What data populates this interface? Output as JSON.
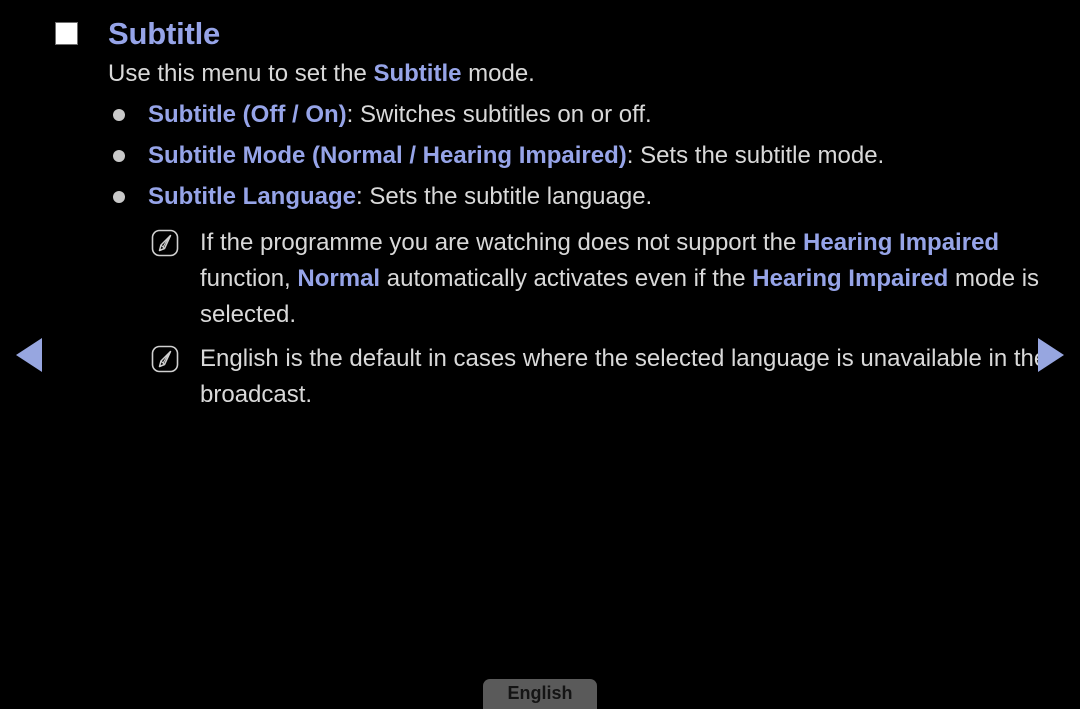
{
  "screen": {
    "background_color": "#000000",
    "accent_blue": "#96a4e8",
    "body_text_color": "#d9d9d9"
  },
  "heading": {
    "marker_icon": "white-square-icon",
    "title": "Subtitle"
  },
  "lead": {
    "before": "Use this menu to set the ",
    "emphasis": "Subtitle",
    "after": " mode."
  },
  "bullets": [
    {
      "bullet_icon": "dot-bullet-icon",
      "term": "Subtitle (Off / On)",
      "separator": ": ",
      "description": "Switches subtitles on or off."
    },
    {
      "bullet_icon": "dot-bullet-icon",
      "term": "Subtitle Mode (Normal / Hearing Impaired)",
      "separator": ": ",
      "description": "Sets the subtitle mode."
    },
    {
      "bullet_icon": "dot-bullet-icon",
      "term": "Subtitle Language",
      "separator": ": ",
      "description": "Sets the subtitle language."
    }
  ],
  "notes": [
    {
      "icon": "note-pencil-icon",
      "segments": [
        {
          "text": "If the programme you are watching does not support the ",
          "style": "normal"
        },
        {
          "text": "Hearing Impaired",
          "style": "blue-bold"
        },
        {
          "text": " function, ",
          "style": "normal"
        },
        {
          "text": "Normal",
          "style": "blue-bold"
        },
        {
          "text": " automatically activates even if the ",
          "style": "normal"
        },
        {
          "text": "Hearing Impaired",
          "style": "blue-bold"
        },
        {
          "text": " mode is selected.",
          "style": "normal"
        }
      ],
      "plain_text": "If the programme you are watching does not support the Hearing Impaired function, Normal automatically activates even if the Hearing Impaired mode is selected."
    },
    {
      "icon": "note-pencil-icon",
      "segments": [
        {
          "text": "English is the default in cases where the selected language is unavailable in the broadcast.",
          "style": "normal"
        }
      ],
      "plain_text": "English is the default in cases where the selected language is unavailable in the broadcast."
    }
  ],
  "navigation": {
    "previous_icon": "triangle-left-icon",
    "next_icon": "triangle-right-icon",
    "arrow_color": "#97a6e0"
  },
  "footer": {
    "language_label": "English",
    "language_button_color": "#5a5a5a"
  }
}
